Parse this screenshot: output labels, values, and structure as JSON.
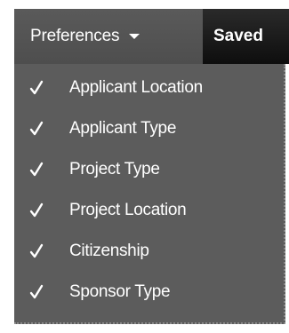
{
  "toolbar": {
    "preferences_label": "Preferences",
    "saved_label": "Saved"
  },
  "menu": {
    "items": [
      {
        "label": "Applicant Location",
        "checked": true
      },
      {
        "label": "Applicant Type",
        "checked": true
      },
      {
        "label": "Project Type",
        "checked": true
      },
      {
        "label": "Project Location",
        "checked": true
      },
      {
        "label": "Citizenship",
        "checked": true
      },
      {
        "label": "Sponsor Type",
        "checked": true
      }
    ]
  },
  "colors": {
    "menu_bg": "#5c5c5c",
    "tab_bg": "#555555",
    "toolbar_bg": "#1c1c1c",
    "text": "#ffffff"
  }
}
